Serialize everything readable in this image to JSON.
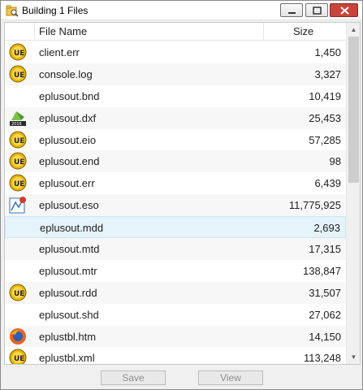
{
  "window": {
    "title": "Building 1 Files"
  },
  "columns": {
    "name": "File Name",
    "size": "Size"
  },
  "files": [
    {
      "name": "client.err",
      "size": "1,450",
      "icon": "ultraedit-icon"
    },
    {
      "name": "console.log",
      "size": "3,327",
      "icon": "ultraedit-icon"
    },
    {
      "name": "eplusout.bnd",
      "size": "10,419",
      "icon": ""
    },
    {
      "name": "eplusout.dxf",
      "size": "25,453",
      "icon": "autocad-icon"
    },
    {
      "name": "eplusout.eio",
      "size": "57,285",
      "icon": "ultraedit-icon"
    },
    {
      "name": "eplusout.end",
      "size": "98",
      "icon": "ultraedit-icon"
    },
    {
      "name": "eplusout.err",
      "size": "6,439",
      "icon": "ultraedit-icon"
    },
    {
      "name": "eplusout.eso",
      "size": "11,775,925",
      "icon": "chart-app-icon"
    },
    {
      "name": "eplusout.mdd",
      "size": "2,693",
      "icon": ""
    },
    {
      "name": "eplusout.mtd",
      "size": "17,315",
      "icon": ""
    },
    {
      "name": "eplusout.mtr",
      "size": "138,847",
      "icon": ""
    },
    {
      "name": "eplusout.rdd",
      "size": "31,507",
      "icon": "ultraedit-icon"
    },
    {
      "name": "eplusout.shd",
      "size": "27,062",
      "icon": ""
    },
    {
      "name": "eplustbl.htm",
      "size": "14,150",
      "icon": "firefox-icon"
    },
    {
      "name": "eplustbl.xml",
      "size": "113,248",
      "icon": "ultraedit-icon"
    }
  ],
  "buttons": {
    "save": "Save",
    "view": "View"
  },
  "selected_index": 8
}
